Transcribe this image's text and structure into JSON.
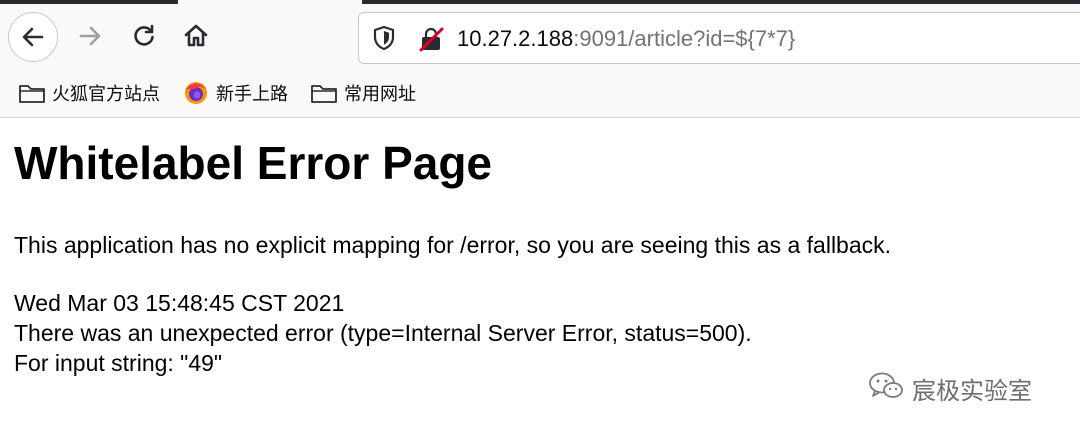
{
  "toolbar": {
    "url_host": "10.27.2.188",
    "url_rest": ":9091/article?id=${7*7}"
  },
  "bookmarks": [
    {
      "label": "火狐官方站点",
      "icon": "folder-icon"
    },
    {
      "label": "新手上路",
      "icon": "firefox-icon"
    },
    {
      "label": "常用网址",
      "icon": "folder-icon"
    }
  ],
  "page": {
    "title": "Whitelabel Error Page",
    "message": "This application has no explicit mapping for /error, so you are seeing this as a fallback.",
    "timestamp": "Wed Mar 03 15:48:45 CST 2021",
    "error_line": "There was an unexpected error (type=Internal Server Error, status=500).",
    "detail": "For input string: \"49\""
  },
  "watermark": {
    "text": "宸极实验室",
    "icon": "wechat-icon"
  },
  "colors": {
    "toolbar_bg": "#f9f9fa",
    "lock_warning": "#d70022",
    "url_secondary": "#737373"
  }
}
